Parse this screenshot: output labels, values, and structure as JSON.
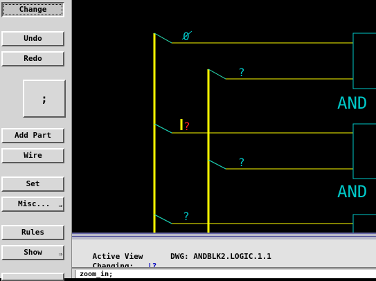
{
  "sidebar": {
    "change": "Change",
    "undo": "Undo",
    "redo": "Redo",
    "semicolon": ";",
    "add_part": "Add Part",
    "wire": "Wire",
    "set": "Set",
    "misc": "Misc...",
    "rules": "Rules",
    "show": "Show",
    "submenu_glyph": "⇒"
  },
  "canvas": {
    "label_zero": "0",
    "label_q1": "?",
    "label_q2": "?",
    "label_q_red": "?",
    "label_q3": "?",
    "label_q4": "?",
    "and_label_1": "AND",
    "and_label_2": "AND",
    "colors": {
      "wire": "#ffff00",
      "outline": "#00c8c8",
      "warn": "#ff2020",
      "bg": "#000000"
    }
  },
  "status": {
    "active_view_label": "Active View",
    "dwg_label": "DWG:",
    "dwg_value": "ANDBLK2.LOGIC.1.1",
    "changing_label": "Changing:",
    "changing_value": "|?"
  },
  "command": {
    "prompt": "zoom_in;"
  }
}
